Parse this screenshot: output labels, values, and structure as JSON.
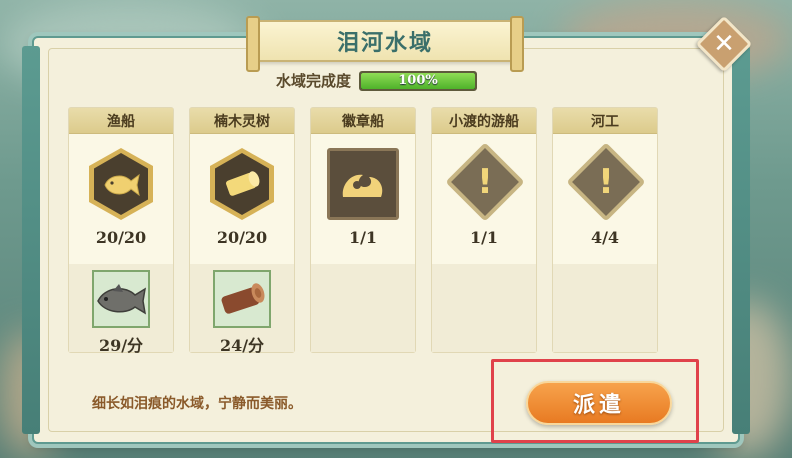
{
  "title": "泪河水域",
  "completion": {
    "label": "水域完成度",
    "value": "100%",
    "fraction": 1.0
  },
  "columns": [
    {
      "header": "渔船",
      "icon": "fish-icon",
      "count": "20/20",
      "product_icon": "carp-icon",
      "rate": "29/分"
    },
    {
      "header": "楠木灵树",
      "icon": "log-icon",
      "count": "20/20",
      "product_icon": "timber-icon",
      "rate": "24/分"
    },
    {
      "header": "徽章船",
      "icon": "wave-emblem-icon",
      "count": "1/1"
    },
    {
      "header": "小渡的游船",
      "icon": "exclamation-icon",
      "count": "1/1"
    },
    {
      "header": "河工",
      "icon": "exclamation-icon",
      "count": "4/4"
    }
  ],
  "description": "细长如泪痕的水域，宁静而美丽。",
  "buttons": {
    "dispatch": "派遣",
    "close": "✕"
  }
}
